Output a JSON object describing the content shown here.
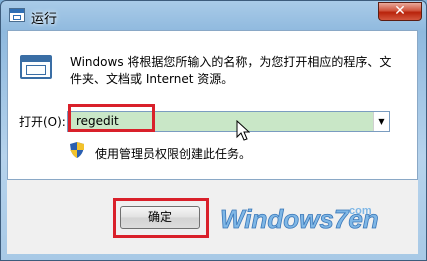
{
  "window": {
    "title": "运行",
    "close_glyph": "✕"
  },
  "dialog": {
    "description": "Windows 将根据您所输入的名称，为您打开相应的程序、文件夹、文档或 Internet 资源。",
    "open_label": "打开(O):",
    "command_value": "regedit",
    "admin_note": "使用管理员权限创建此任务。"
  },
  "buttons": {
    "ok_label": "确定"
  },
  "watermark": {
    "logo_text": "Windows7en",
    "logo_domain": ".com"
  },
  "colors": {
    "highlight": "#d9202a",
    "input_selection": "#c9e7c7"
  },
  "icons": [
    "run-app-icon",
    "close-icon",
    "run-dialog-icon",
    "dropdown-arrow-icon",
    "shield-icon",
    "mouse-cursor-icon"
  ]
}
